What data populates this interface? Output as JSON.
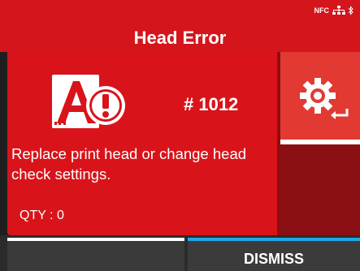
{
  "header": {
    "title": "Head Error",
    "status_icons": [
      "nfc-icon",
      "network-icon",
      "bluetooth-icon"
    ],
    "nfc_label": "NFC"
  },
  "error": {
    "icon": "print-head-error-icon",
    "code": "# 1012",
    "message": "Replace print head or change head check settings.",
    "qty": "QTY : 0"
  },
  "side": {
    "settings_icon": "gear-enter-icon"
  },
  "softkeys": {
    "left_label": "",
    "right_label": "DISMISS"
  },
  "colors": {
    "header_red": "#d4151c",
    "panel_red": "#d8141a",
    "accent_blue": "#1fa8e8"
  }
}
